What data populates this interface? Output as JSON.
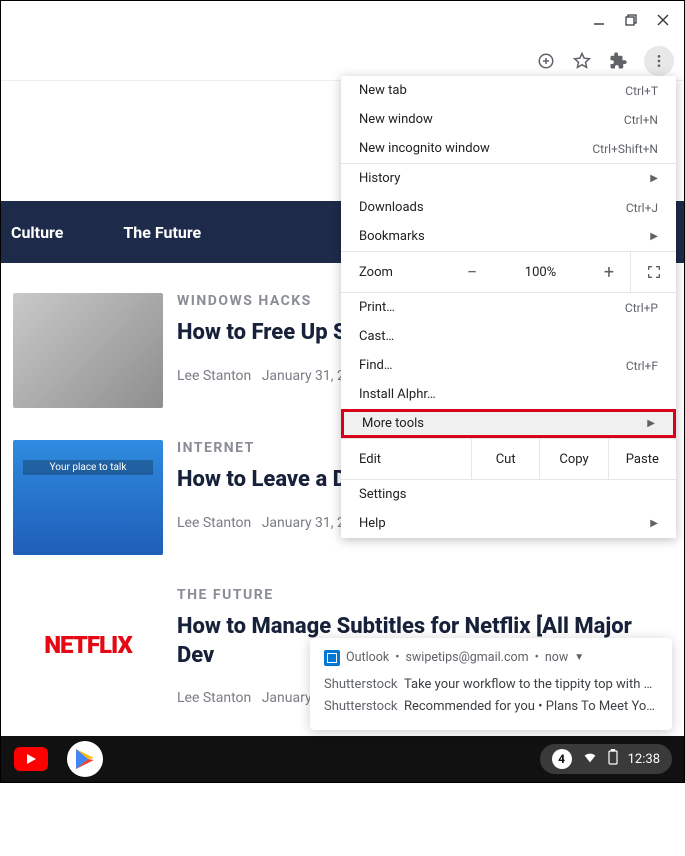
{
  "nav": {
    "culture": "Culture",
    "future": "The Future"
  },
  "articles": [
    {
      "cat": "WINDOWS HACKS",
      "title": "How to Free Up S",
      "author": "Lee Stanton",
      "date": "January 31, 20"
    },
    {
      "cat": "INTERNET",
      "title": "How to Leave a D",
      "author": "Lee Stanton",
      "date": "January 31, 20"
    },
    {
      "cat": "THE FUTURE",
      "title": "How to Manage Subtitles for Netflix [All Major Dev",
      "author": "Lee Stanton",
      "date": "January"
    }
  ],
  "menu": {
    "new_tab": "New tab",
    "sc_new_tab": "Ctrl+T",
    "new_window": "New window",
    "sc_new_window": "Ctrl+N",
    "incognito": "New incognito window",
    "sc_incognito": "Ctrl+Shift+N",
    "history": "History",
    "downloads": "Downloads",
    "sc_downloads": "Ctrl+J",
    "bookmarks": "Bookmarks",
    "zoom": "Zoom",
    "minus": "−",
    "pct": "100%",
    "plus": "+",
    "print": "Print…",
    "sc_print": "Ctrl+P",
    "cast": "Cast…",
    "find": "Find…",
    "sc_find": "Ctrl+F",
    "install": "Install Alphr…",
    "more_tools": "More tools",
    "edit": "Edit",
    "cut": "Cut",
    "copy": "Copy",
    "paste": "Paste",
    "settings": "Settings",
    "help": "Help"
  },
  "notif": {
    "app": "Outlook",
    "sep": "•",
    "email": "swipetips@gmail.com",
    "time": "now",
    "l1_s": "Shutterstock",
    "l1": "Take your workflow to the tippity top with C…",
    "l2_s": "Shutterstock",
    "l2": "Recommended for you • Plans To Meet Yo…"
  },
  "shelf": {
    "count": "4",
    "time": "12:38"
  },
  "thumb3": "NETFLIX"
}
